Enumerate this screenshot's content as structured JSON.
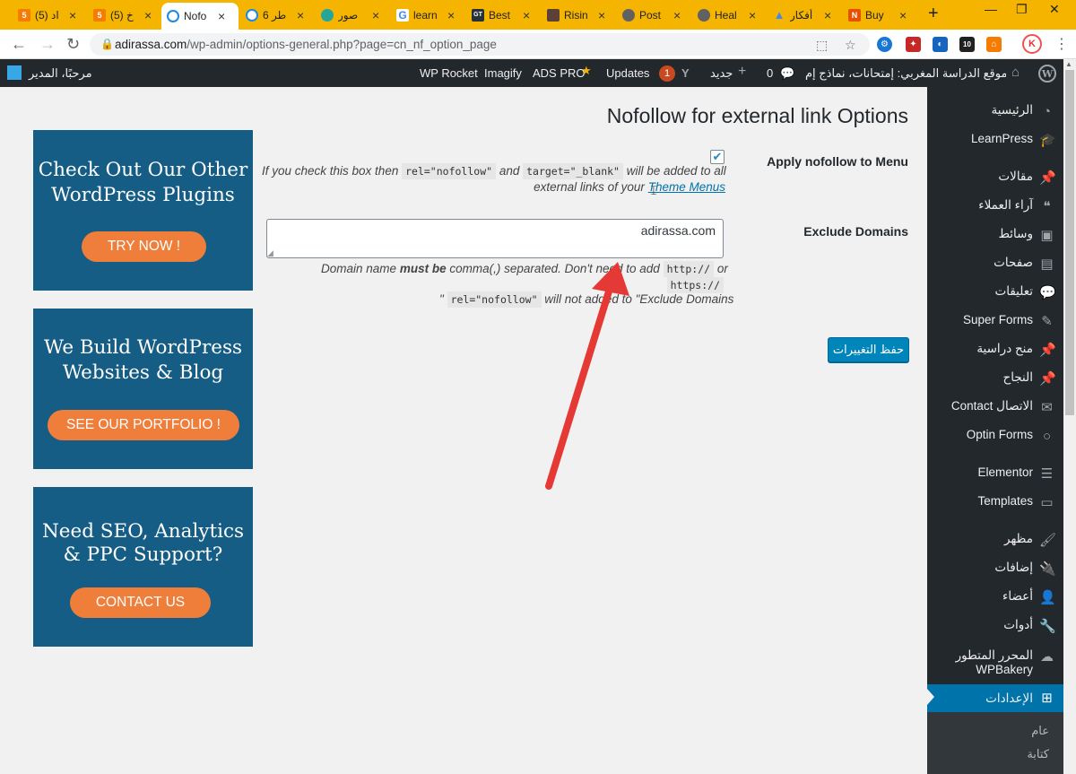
{
  "browser": {
    "tabs": [
      {
        "title": "(5) اد",
        "favicon_text": "5",
        "favicon_color": "#f57c00"
      },
      {
        "title": "(5) خ",
        "favicon_text": "5",
        "favicon_color": "#f57c00"
      },
      {
        "title": "Nofo",
        "favicon_text": "",
        "favicon_color": "#1e88e5",
        "active": true
      },
      {
        "title": "6 طر",
        "favicon_text": "",
        "favicon_color": "#1e88e5"
      },
      {
        "title": "صور",
        "favicon_text": "",
        "favicon_color": "#26a69a"
      },
      {
        "title": "learn",
        "favicon_text": "G",
        "favicon_color": "#4285f4"
      },
      {
        "title": "Best",
        "favicon_text": "GT",
        "favicon_color": "#263238"
      },
      {
        "title": "Risin",
        "favicon_text": "",
        "favicon_color": "#5d4037"
      },
      {
        "title": "Post",
        "favicon_text": "",
        "favicon_color": "#616161"
      },
      {
        "title": "Heal",
        "favicon_text": "",
        "favicon_color": "#616161"
      },
      {
        "title": "أفكار",
        "favicon_text": "",
        "favicon_color": "#fbbc04"
      },
      {
        "title": "Buy",
        "favicon_text": "N",
        "favicon_color": "#e65100"
      }
    ],
    "url_domain": "adirassa.com",
    "url_path": "/wp-admin/options-general.php?page=cn_nf_option_page",
    "profile_initial": "K"
  },
  "admin_bar": {
    "site_name": "موقع الدراسة المغربي: إمتحانات، نماذج إم...",
    "comments_count": "0",
    "new_label": "جديد",
    "updates_count": "1",
    "updates_label": "Updates",
    "ads_pro_label": "ADS PRO",
    "imagify_label": "Imagify",
    "wp_rocket_label": "WP Rocket",
    "greeting": "مرحبًا، المدير"
  },
  "menu": {
    "items": [
      {
        "label": "الرئيسية",
        "icon": "gauge-icon"
      },
      {
        "label": "LearnPress",
        "icon": "graduation-cap-icon"
      },
      {
        "label": "مقالات",
        "icon": "pin-icon"
      },
      {
        "label": "آراء العملاء",
        "icon": "quote-icon"
      },
      {
        "label": "وسائط",
        "icon": "media-icon"
      },
      {
        "label": "صفحات",
        "icon": "pages-icon"
      },
      {
        "label": "تعليقات",
        "icon": "comment-icon"
      },
      {
        "label": "Super Forms",
        "icon": "forms-icon"
      },
      {
        "label": "منح دراسية",
        "icon": "pin-icon"
      },
      {
        "label": "النجاح",
        "icon": "pin-icon"
      },
      {
        "label": "Contact الاتصال",
        "icon": "mail-icon"
      },
      {
        "label": "Optin Forms",
        "icon": "circle-icon"
      },
      {
        "label": "Elementor",
        "icon": "elementor-icon"
      },
      {
        "label": "Templates",
        "icon": "folder-icon"
      },
      {
        "label": "مظهر",
        "icon": "brush-icon"
      },
      {
        "label": "إضافات",
        "icon": "plugin-icon"
      },
      {
        "label": "أعضاء",
        "icon": "user-icon"
      },
      {
        "label": "أدوات",
        "icon": "wrench-icon"
      },
      {
        "label": "المحرر المتطور WPBakery",
        "icon": "cloud-icon"
      },
      {
        "label": "الإعدادات",
        "icon": "settings-icon",
        "current": true
      }
    ],
    "submenu": [
      "عام",
      "كتابة"
    ]
  },
  "page": {
    "title": "Nofollow for external link Options",
    "apply_label": "Apply nofollow to Menu",
    "apply_checked": true,
    "apply_desc_1": "If you check this box then",
    "apply_code_rel": "rel=\"nofollow\"",
    "apply_desc_and": "and",
    "apply_code_target": "target=\"_blank\"",
    "apply_desc_2": "will be added to all",
    "apply_desc_3": "external links of your",
    "apply_link": "Theme Menus",
    "exclude_label": "Exclude Domains",
    "exclude_value": "adirassa.com",
    "exclude_desc_1": "Domain name",
    "exclude_desc_bold": "must be",
    "exclude_desc_2": "comma(,) separated. Don't need to add",
    "exclude_code_http": "http://",
    "exclude_desc_or": "or",
    "exclude_code_https": "https://",
    "exclude_desc_quote": "\"",
    "exclude_code_rel": "rel=\"nofollow\"",
    "exclude_desc_3": "will not added to \"Exclude Domains",
    "save_button": "حفظ التغييرات"
  },
  "promos": [
    {
      "heading_1": "Check Out Our Other",
      "heading_2": "WordPress Plugins",
      "button": "TRY NOW !"
    },
    {
      "heading_1": "We Build WordPress",
      "heading_2": "Websites & Blog",
      "button": "SEE OUR PORTFOLIO !"
    },
    {
      "heading_1": "Need SEO, Analytics",
      "heading_2": "& PPC Support?",
      "button": "CONTACT US"
    }
  ],
  "colors": {
    "admin_dark": "#23282d",
    "wp_blue": "#0073aa",
    "promo_bg": "#155d84",
    "promo_button": "#ef7e3a",
    "annotation_arrow": "#e53935",
    "chrome_tabstrip": "#f4b400"
  }
}
